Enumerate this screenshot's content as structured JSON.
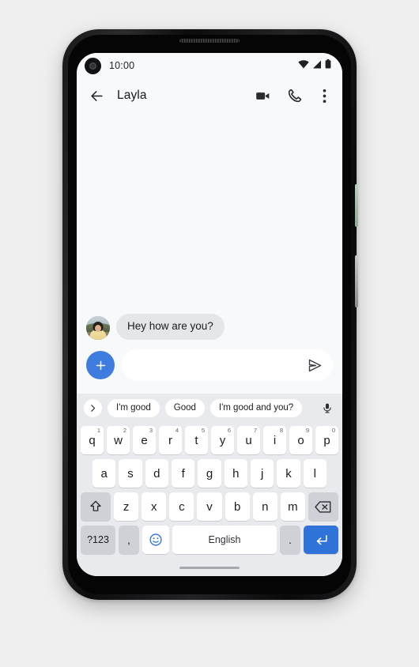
{
  "status_bar": {
    "time": "10:00",
    "icons": [
      "wifi-icon",
      "cellular-signal-icon",
      "battery-icon"
    ]
  },
  "app_bar": {
    "back_icon": "back-arrow-icon",
    "title": "Layla",
    "actions": [
      {
        "icon": "video-call-icon"
      },
      {
        "icon": "phone-call-icon"
      },
      {
        "icon": "overflow-menu-icon"
      }
    ]
  },
  "conversation": {
    "messages": [
      {
        "sender": "Layla",
        "text": "Hey how are you?",
        "incoming": true,
        "avatar": "contact-avatar"
      }
    ]
  },
  "compose": {
    "attach_icon": "plus-icon",
    "input_value": "",
    "input_placeholder": "",
    "send_icon": "send-icon"
  },
  "suggestions": {
    "expand_icon": "chevron-right-icon",
    "chips": [
      "I'm good",
      "Good",
      "I'm good and you?"
    ],
    "mic_icon": "microphone-icon"
  },
  "keyboard": {
    "row1": [
      {
        "label": "q",
        "sup": "1"
      },
      {
        "label": "w",
        "sup": "2"
      },
      {
        "label": "e",
        "sup": "3"
      },
      {
        "label": "r",
        "sup": "4"
      },
      {
        "label": "t",
        "sup": "5"
      },
      {
        "label": "y",
        "sup": "6"
      },
      {
        "label": "u",
        "sup": "7"
      },
      {
        "label": "i",
        "sup": "8"
      },
      {
        "label": "o",
        "sup": "9"
      },
      {
        "label": "p",
        "sup": "0"
      }
    ],
    "row2": [
      {
        "label": "a"
      },
      {
        "label": "s"
      },
      {
        "label": "d"
      },
      {
        "label": "f"
      },
      {
        "label": "g"
      },
      {
        "label": "h"
      },
      {
        "label": "j"
      },
      {
        "label": "k"
      },
      {
        "label": "l"
      }
    ],
    "row3": [
      {
        "label": "z"
      },
      {
        "label": "x"
      },
      {
        "label": "c"
      },
      {
        "label": "v"
      },
      {
        "label": "b"
      },
      {
        "label": "n"
      },
      {
        "label": "m"
      }
    ],
    "shift_icon": "shift-icon",
    "backspace_icon": "backspace-icon",
    "symbols_label": "?123",
    "comma_label": ",",
    "emoji_icon": "emoji-icon",
    "space_label": "English",
    "period_label": ".",
    "enter_icon": "enter-icon"
  },
  "nav": {
    "home_indicator": "home-gesture-bar"
  },
  "colors": {
    "accent_blue": "#3f7ce0",
    "key_blue": "#2f73d9",
    "keyboard_bg": "#e9eaee",
    "bubble_gray": "#e4e6e9",
    "screen_bg": "#f8f9fb"
  }
}
